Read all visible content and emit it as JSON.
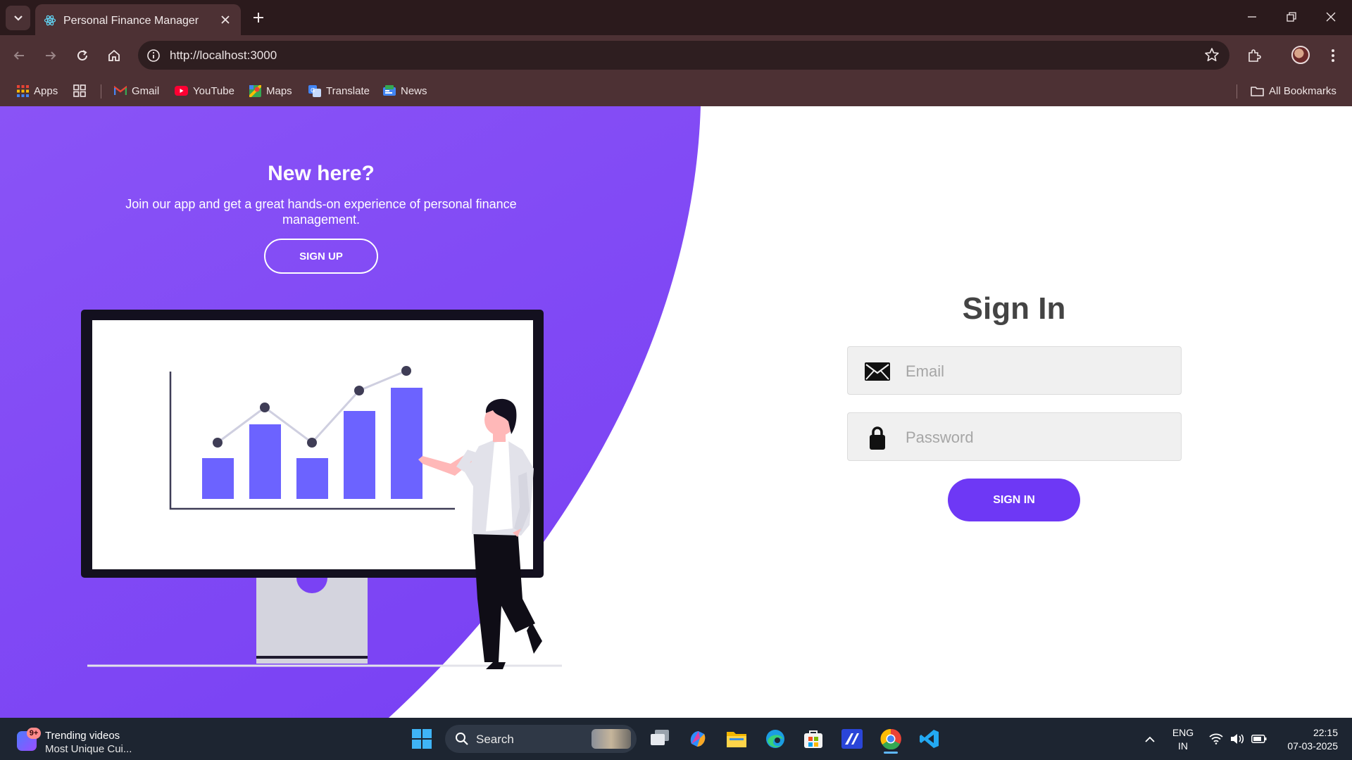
{
  "browser": {
    "tab_title": "Personal Finance Manager",
    "url": "http://localhost:3000",
    "bookmarks": [
      "Apps",
      "Gmail",
      "YouTube",
      "Maps",
      "Translate",
      "News"
    ],
    "all_bookmarks_label": "All Bookmarks"
  },
  "page": {
    "promo": {
      "title": "New here?",
      "text": "Join our app and get a great hands-on experience of personal finance management.",
      "signup_label": "SIGN UP"
    },
    "form": {
      "title": "Sign In",
      "email_placeholder": "Email",
      "password_placeholder": "Password",
      "signin_label": "SIGN IN"
    },
    "colors": {
      "accent": "#6e38f5",
      "panel_light": "#8a53f6",
      "panel_dark": "#7a42f4",
      "bar": "#6c63ff"
    }
  },
  "taskbar": {
    "widget": {
      "badge": "9+",
      "line1": "Trending videos",
      "line2": "Most Unique Cui..."
    },
    "search_label": "Search",
    "lang_line1": "ENG",
    "lang_line2": "IN",
    "time": "22:15",
    "date": "07-03-2025"
  }
}
